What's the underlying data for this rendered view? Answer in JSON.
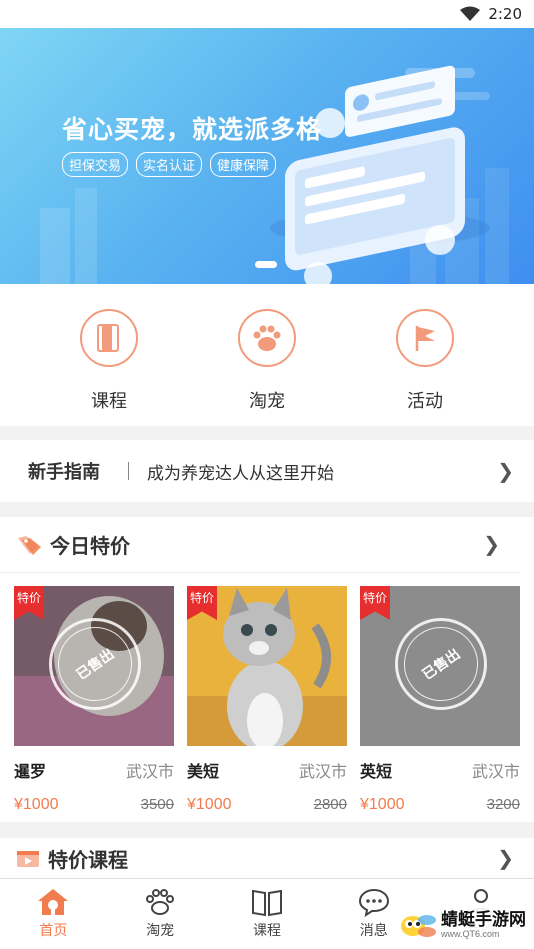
{
  "status": {
    "time": "2:20"
  },
  "banner": {
    "title": "省心买宠，就选派多格",
    "tags": [
      "担保交易",
      "实名认证",
      "健康保障"
    ]
  },
  "quick_nav": [
    {
      "label": "课程",
      "icon": "book-icon"
    },
    {
      "label": "淘宠",
      "icon": "paw-icon"
    },
    {
      "label": "活动",
      "icon": "flag-icon"
    }
  ],
  "guide": {
    "title": "新手指南",
    "text": "成为养宠达人从这里开始"
  },
  "deals": {
    "title": "今日特价",
    "ribbon": "特价",
    "sold_label": "已售出",
    "items": [
      {
        "name": "暹罗",
        "city": "武汉市",
        "price": "¥1000",
        "original_price": "3500",
        "sold": true
      },
      {
        "name": "美短",
        "city": "武汉市",
        "price": "¥1000",
        "original_price": "2800",
        "sold": false
      },
      {
        "name": "英短",
        "city": "武汉市",
        "price": "¥1000",
        "original_price": "3200",
        "sold": true
      }
    ]
  },
  "courses": {
    "title": "特价课程"
  },
  "tabbar": [
    {
      "label": "首页",
      "icon": "home-icon",
      "active": true
    },
    {
      "label": "淘宠",
      "icon": "paw-icon",
      "active": false
    },
    {
      "label": "课程",
      "icon": "book-icon",
      "active": false
    },
    {
      "label": "消息",
      "icon": "chat-icon",
      "active": false
    },
    {
      "label": "我的",
      "icon": "user-icon",
      "active": false
    }
  ],
  "watermark": {
    "text": "蜻蜓手游网",
    "url": "www.QT6.com"
  },
  "colors": {
    "accent": "#f07c4f",
    "ribbon": "#e62e2e",
    "banner_start": "#7fd6f4",
    "banner_end": "#3f8ef0"
  }
}
